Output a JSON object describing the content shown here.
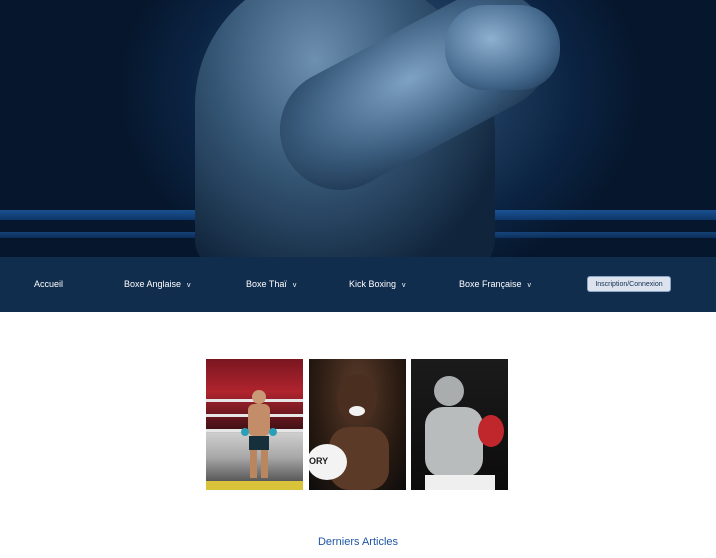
{
  "nav": {
    "items": [
      {
        "label": "Accueil",
        "has_dropdown": false
      },
      {
        "label": "Boxe Anglaise",
        "has_dropdown": true
      },
      {
        "label": "Boxe Thaï",
        "has_dropdown": true
      },
      {
        "label": "Kick Boxing",
        "has_dropdown": true
      },
      {
        "label": "Boxe Française",
        "has_dropdown": true
      }
    ],
    "dropdown_glyph": "v",
    "login_button": "Inscription/Connexion"
  },
  "gallery": {
    "photos": [
      {
        "subject": "boxer-in-ring"
      },
      {
        "subject": "boxer-shouting",
        "visible_text": "ORY"
      },
      {
        "subject": "boxer-guard"
      }
    ]
  },
  "section": {
    "title": "Derniers Articles"
  },
  "colors": {
    "navbar": "#112d4e",
    "accent": "#1f56a3",
    "button_bg": "#dce3ee"
  }
}
